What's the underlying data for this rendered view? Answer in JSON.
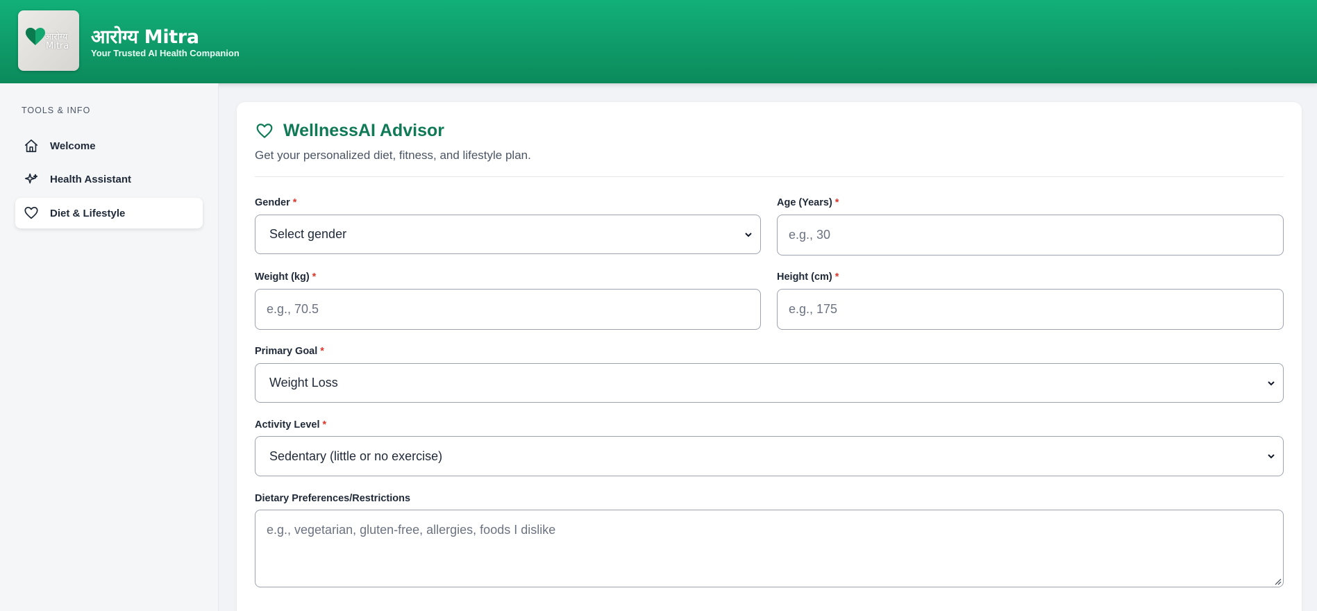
{
  "app": {
    "logo_text_line1": "आरोग्य",
    "logo_text_line2": "Mitra",
    "title": "आरोग्य Mitra",
    "tagline": "Your Trusted AI Health Companion"
  },
  "sidebar": {
    "heading": "TOOLS & INFO",
    "items": [
      {
        "label": "Welcome",
        "icon": "home-icon",
        "active": false
      },
      {
        "label": "Health Assistant",
        "icon": "sparkle-icon",
        "active": false
      },
      {
        "label": "Diet & Lifestyle",
        "icon": "heart-icon",
        "active": true
      }
    ]
  },
  "main": {
    "title": "WellnessAI Advisor",
    "subtitle": "Get your personalized diet, fitness, and lifestyle plan.",
    "required_marker": "*",
    "fields": {
      "gender": {
        "label": "Gender",
        "value": "Select gender"
      },
      "age": {
        "label": "Age (Years)",
        "placeholder": "e.g., 30"
      },
      "weight": {
        "label": "Weight (kg)",
        "placeholder": "e.g., 70.5"
      },
      "height": {
        "label": "Height (cm)",
        "placeholder": "e.g., 175"
      },
      "goal": {
        "label": "Primary Goal",
        "value": "Weight Loss"
      },
      "activity": {
        "label": "Activity Level",
        "value": "Sedentary (little or no exercise)"
      },
      "dietary": {
        "label": "Dietary Preferences/Restrictions",
        "placeholder": "e.g., vegetarian, gluten-free, allergies, foods I dislike"
      }
    }
  },
  "colors": {
    "header_gradient_top": "#12b079",
    "header_gradient_bottom": "#0c8a5c",
    "accent": "#0f7a55",
    "required": "#e0362c"
  }
}
